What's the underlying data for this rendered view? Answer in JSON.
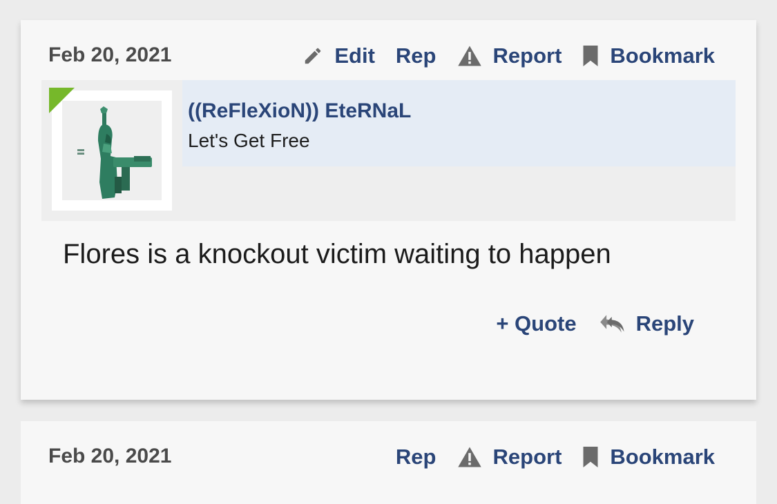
{
  "posts": [
    {
      "date": "Feb 20, 2021",
      "actions": {
        "edit": "Edit",
        "rep": "Rep",
        "report": "Report",
        "bookmark": "Bookmark"
      },
      "user": {
        "name": "((ReFleXioN)) EteRNaL",
        "title": "Let's Get Free",
        "online": true
      },
      "body": "Flores is a knockout victim waiting to happen",
      "footer": {
        "quote": "+ Quote",
        "reply": "Reply"
      }
    },
    {
      "date": "Feb 20, 2021",
      "actions": {
        "rep": "Rep",
        "report": "Report",
        "bookmark": "Bookmark"
      }
    }
  ],
  "colors": {
    "link": "#2a4578",
    "online_indicator": "#76b82a",
    "user_info_bg": "#e5ecf5",
    "icon_gray": "#6b6b6b"
  },
  "icons": {
    "edit": "pencil-icon",
    "report": "warning-icon",
    "bookmark": "bookmark-icon",
    "reply": "reply-icon"
  }
}
